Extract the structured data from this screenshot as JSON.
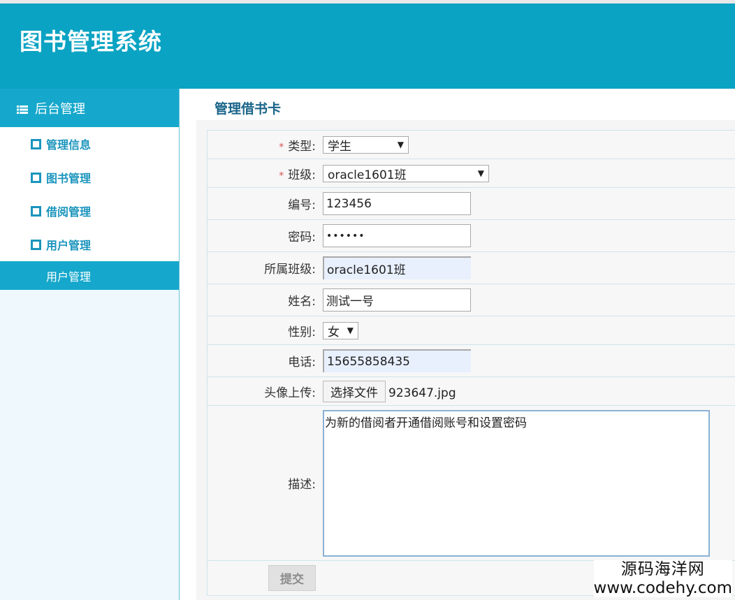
{
  "header": {
    "title": "图书管理系统"
  },
  "sidebar": {
    "heading": "后台管理",
    "items": [
      {
        "label": "管理信息"
      },
      {
        "label": "图书管理"
      },
      {
        "label": "借阅管理"
      },
      {
        "label": "用户管理"
      }
    ],
    "active_subitem": "用户管理"
  },
  "main": {
    "page_title": "管理借书卡",
    "form": {
      "type": {
        "label": "类型:",
        "value": "学生",
        "required": true
      },
      "class": {
        "label": "班级:",
        "value": "oracle1601班",
        "required": true
      },
      "number": {
        "label": "编号:",
        "value": "123456"
      },
      "password": {
        "label": "密码:",
        "value": "••••••"
      },
      "belong_class": {
        "label": "所属班级:",
        "value": "oracle1601班"
      },
      "name": {
        "label": "姓名:",
        "value": "测试一号"
      },
      "gender": {
        "label": "性别:",
        "value": "女"
      },
      "phone": {
        "label": "电话:",
        "value": "15655858435"
      },
      "avatar": {
        "label": "头像上传:",
        "button": "选择文件",
        "file": "923647.jpg"
      },
      "description": {
        "label": "描述:",
        "value": "为新的借阅者开通借阅账号和设置密码"
      },
      "submit": "提交",
      "required_mark": "*"
    }
  },
  "watermark": {
    "cn": "源码海洋网",
    "en": "www.codehy.com"
  }
}
